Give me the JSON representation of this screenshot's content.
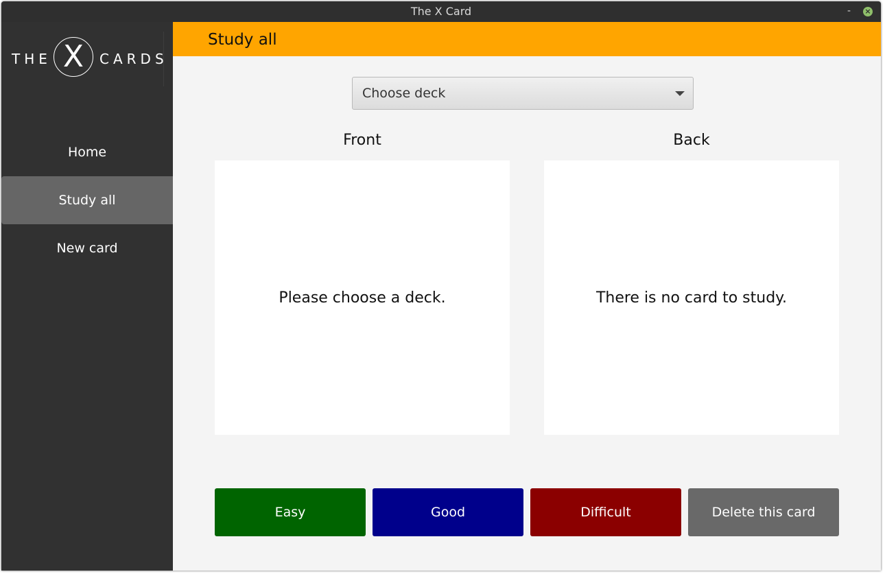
{
  "window": {
    "title": "The X Card",
    "minimize_glyph": "-",
    "close_glyph": "×"
  },
  "sidebar": {
    "logo": {
      "left_word": "THE",
      "center_mark": "X",
      "right_word": "CARDS"
    },
    "items": [
      {
        "label": "Home",
        "active": false
      },
      {
        "label": "Study all",
        "active": true
      },
      {
        "label": "New card",
        "active": false
      }
    ]
  },
  "header": {
    "title": "Study all",
    "color": "#ffa500"
  },
  "deck_select": {
    "selected": "Choose deck"
  },
  "study": {
    "front": {
      "heading": "Front",
      "text": "Please choose a deck."
    },
    "back": {
      "heading": "Back",
      "text": "There is no card to study."
    }
  },
  "actions": [
    {
      "label": "Easy",
      "color": "#006400"
    },
    {
      "label": "Good",
      "color": "#00008b"
    },
    {
      "label": "Difficult",
      "color": "#8b0000"
    },
    {
      "label": "Delete this card",
      "color": "#696969"
    }
  ],
  "icons": {
    "dropdown": "caret-down-icon",
    "close": "close-icon",
    "minimize": "minimize-icon"
  }
}
